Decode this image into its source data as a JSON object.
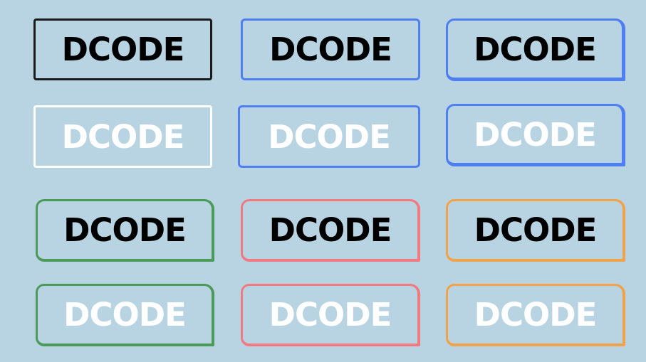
{
  "colors": {
    "background": "#b8d4e2",
    "black": "#1a1a1a",
    "white": "#ffffff",
    "blue": "#4f7ef0",
    "green": "#4b9a5a",
    "red": "#f07a80",
    "orange": "#f2a34a"
  },
  "buttons": [
    {
      "label": "DCODE",
      "border_color": "black",
      "text_color": "black"
    },
    {
      "label": "DCODE",
      "border_color": "blue",
      "text_color": "black"
    },
    {
      "label": "DCODE",
      "border_color": "blue",
      "text_color": "black"
    },
    {
      "label": "DCODE",
      "border_color": "white",
      "text_color": "white"
    },
    {
      "label": "DCODE",
      "border_color": "blue",
      "text_color": "white"
    },
    {
      "label": "DCODE",
      "border_color": "blue",
      "text_color": "white"
    },
    {
      "label": "DCODE",
      "border_color": "green",
      "text_color": "black"
    },
    {
      "label": "DCODE",
      "border_color": "red",
      "text_color": "black"
    },
    {
      "label": "DCODE",
      "border_color": "orange",
      "text_color": "black"
    },
    {
      "label": "DCODE",
      "border_color": "green",
      "text_color": "white"
    },
    {
      "label": "DCODE",
      "border_color": "red",
      "text_color": "white"
    },
    {
      "label": "DCODE",
      "border_color": "orange",
      "text_color": "white"
    }
  ]
}
